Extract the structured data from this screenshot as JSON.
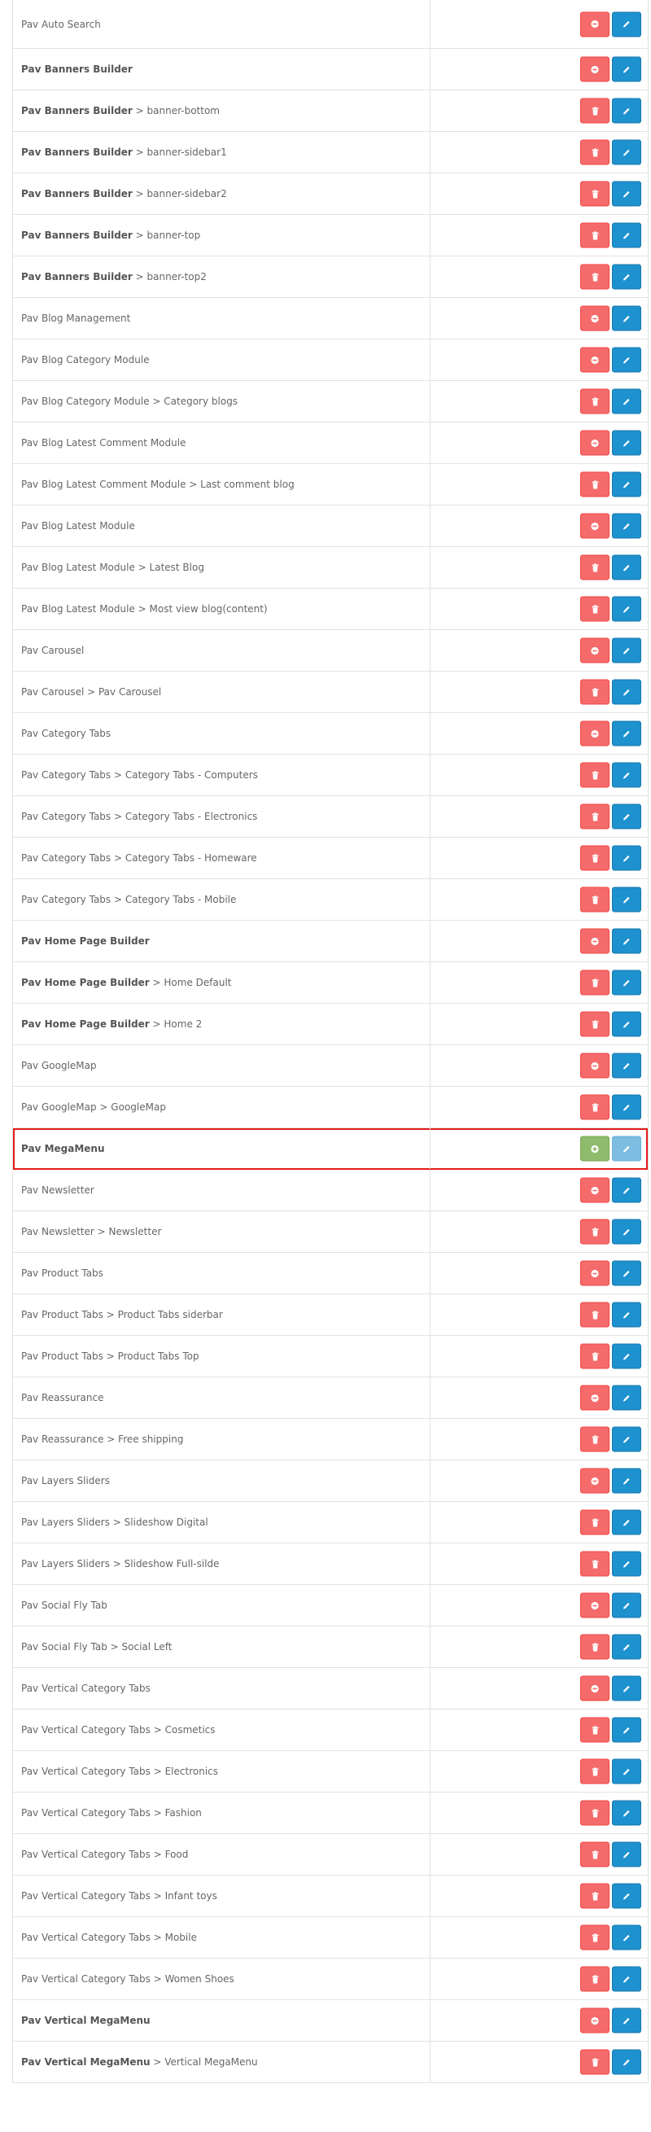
{
  "colors": {
    "danger": "#f56b6b",
    "success": "#8fbb6c",
    "primary": "#1e91cf",
    "primary_disabled": "#7cbde1",
    "highlight_border": "#e31b1b"
  },
  "modules": [
    {
      "parent": "Pav Auto Search",
      "child": "",
      "bold": false,
      "action": "uninstall",
      "edit_enabled": true
    },
    {
      "parent": "Pav Banners Builder",
      "child": "",
      "bold": true,
      "action": "uninstall",
      "edit_enabled": true
    },
    {
      "parent": "Pav Banners Builder",
      "child": "banner-bottom",
      "bold": true,
      "action": "delete",
      "edit_enabled": true
    },
    {
      "parent": "Pav Banners Builder",
      "child": "banner-sidebar1",
      "bold": true,
      "action": "delete",
      "edit_enabled": true
    },
    {
      "parent": "Pav Banners Builder",
      "child": "banner-sidebar2",
      "bold": true,
      "action": "delete",
      "edit_enabled": true
    },
    {
      "parent": "Pav Banners Builder",
      "child": "banner-top",
      "bold": true,
      "action": "delete",
      "edit_enabled": true
    },
    {
      "parent": "Pav Banners Builder",
      "child": "banner-top2",
      "bold": true,
      "action": "delete",
      "edit_enabled": true
    },
    {
      "parent": "Pav Blog Management",
      "child": "",
      "bold": false,
      "action": "uninstall",
      "edit_enabled": true
    },
    {
      "parent": "Pav Blog Category Module",
      "child": "",
      "bold": false,
      "action": "uninstall",
      "edit_enabled": true
    },
    {
      "parent": "Pav Blog Category Module",
      "child": "Category blogs",
      "bold": false,
      "action": "delete",
      "edit_enabled": true
    },
    {
      "parent": "Pav Blog Latest Comment Module",
      "child": "",
      "bold": false,
      "action": "uninstall",
      "edit_enabled": true
    },
    {
      "parent": "Pav Blog Latest Comment Module",
      "child": "Last comment blog",
      "bold": false,
      "action": "delete",
      "edit_enabled": true
    },
    {
      "parent": "Pav Blog Latest Module",
      "child": "",
      "bold": false,
      "action": "uninstall",
      "edit_enabled": true
    },
    {
      "parent": "Pav Blog Latest Module",
      "child": "Latest Blog",
      "bold": false,
      "action": "delete",
      "edit_enabled": true
    },
    {
      "parent": "Pav Blog Latest Module",
      "child": "Most view blog(content)",
      "bold": false,
      "action": "delete",
      "edit_enabled": true
    },
    {
      "parent": "Pav Carousel",
      "child": "",
      "bold": false,
      "action": "uninstall",
      "edit_enabled": true
    },
    {
      "parent": "Pav Carousel",
      "child": "Pav Carousel",
      "bold": false,
      "action": "delete",
      "edit_enabled": true
    },
    {
      "parent": "Pav Category Tabs",
      "child": "",
      "bold": false,
      "action": "uninstall",
      "edit_enabled": true
    },
    {
      "parent": "Pav Category Tabs",
      "child": "Category Tabs - Computers",
      "bold": false,
      "action": "delete",
      "edit_enabled": true
    },
    {
      "parent": "Pav Category Tabs",
      "child": "Category Tabs - Electronics",
      "bold": false,
      "action": "delete",
      "edit_enabled": true
    },
    {
      "parent": "Pav Category Tabs",
      "child": "Category Tabs - Homeware",
      "bold": false,
      "action": "delete",
      "edit_enabled": true
    },
    {
      "parent": "Pav Category Tabs",
      "child": "Category Tabs - Mobile",
      "bold": false,
      "action": "delete",
      "edit_enabled": true
    },
    {
      "parent": "Pav Home Page Builder",
      "child": "",
      "bold": true,
      "action": "uninstall",
      "edit_enabled": true
    },
    {
      "parent": "Pav Home Page Builder",
      "child": "Home Default",
      "bold": true,
      "action": "delete",
      "edit_enabled": true
    },
    {
      "parent": "Pav Home Page Builder",
      "child": "Home 2",
      "bold": true,
      "action": "delete",
      "edit_enabled": true
    },
    {
      "parent": "Pav GoogleMap",
      "child": "",
      "bold": false,
      "action": "uninstall",
      "edit_enabled": true
    },
    {
      "parent": "Pav GoogleMap",
      "child": "GoogleMap",
      "bold": false,
      "action": "delete",
      "edit_enabled": true
    },
    {
      "parent": "Pav MegaMenu",
      "child": "",
      "bold": true,
      "action": "install",
      "edit_enabled": false,
      "highlight": true
    },
    {
      "parent": "Pav Newsletter",
      "child": "",
      "bold": false,
      "action": "uninstall",
      "edit_enabled": true
    },
    {
      "parent": "Pav Newsletter",
      "child": "Newsletter",
      "bold": false,
      "action": "delete",
      "edit_enabled": true
    },
    {
      "parent": "Pav Product Tabs",
      "child": "",
      "bold": false,
      "action": "uninstall",
      "edit_enabled": true
    },
    {
      "parent": "Pav Product Tabs",
      "child": "Product Tabs siderbar",
      "bold": false,
      "action": "delete",
      "edit_enabled": true
    },
    {
      "parent": "Pav Product Tabs",
      "child": "Product Tabs Top",
      "bold": false,
      "action": "delete",
      "edit_enabled": true
    },
    {
      "parent": "Pav Reassurance",
      "child": "",
      "bold": false,
      "action": "uninstall",
      "edit_enabled": true
    },
    {
      "parent": "Pav Reassurance",
      "child": "Free shipping",
      "bold": false,
      "action": "delete",
      "edit_enabled": true
    },
    {
      "parent": "Pav Layers Sliders",
      "child": "",
      "bold": false,
      "action": "uninstall",
      "edit_enabled": true
    },
    {
      "parent": "Pav Layers Sliders",
      "child": "Slideshow Digital",
      "bold": false,
      "action": "delete",
      "edit_enabled": true
    },
    {
      "parent": "Pav Layers Sliders",
      "child": "Slideshow Full-silde",
      "bold": false,
      "action": "delete",
      "edit_enabled": true
    },
    {
      "parent": "Pav Social Fly Tab",
      "child": "",
      "bold": false,
      "action": "uninstall",
      "edit_enabled": true
    },
    {
      "parent": "Pav Social Fly Tab",
      "child": "Social Left",
      "bold": false,
      "action": "delete",
      "edit_enabled": true
    },
    {
      "parent": "Pav Vertical Category Tabs",
      "child": "",
      "bold": false,
      "action": "uninstall",
      "edit_enabled": true
    },
    {
      "parent": "Pav Vertical Category Tabs",
      "child": "Cosmetics",
      "bold": false,
      "action": "delete",
      "edit_enabled": true
    },
    {
      "parent": "Pav Vertical Category Tabs",
      "child": "Electronics",
      "bold": false,
      "action": "delete",
      "edit_enabled": true
    },
    {
      "parent": "Pav Vertical Category Tabs",
      "child": "Fashion",
      "bold": false,
      "action": "delete",
      "edit_enabled": true
    },
    {
      "parent": "Pav Vertical Category Tabs",
      "child": "Food",
      "bold": false,
      "action": "delete",
      "edit_enabled": true
    },
    {
      "parent": "Pav Vertical Category Tabs",
      "child": "Infant toys",
      "bold": false,
      "action": "delete",
      "edit_enabled": true
    },
    {
      "parent": "Pav Vertical Category Tabs",
      "child": "Mobile",
      "bold": false,
      "action": "delete",
      "edit_enabled": true
    },
    {
      "parent": "Pav Vertical Category Tabs",
      "child": "Women Shoes",
      "bold": false,
      "action": "delete",
      "edit_enabled": true
    },
    {
      "parent": "Pav Vertical MegaMenu",
      "child": "",
      "bold": true,
      "action": "uninstall",
      "edit_enabled": true
    },
    {
      "parent": "Pav Vertical MegaMenu",
      "child": "Vertical MegaMenu",
      "bold": true,
      "action": "delete",
      "edit_enabled": true
    }
  ]
}
